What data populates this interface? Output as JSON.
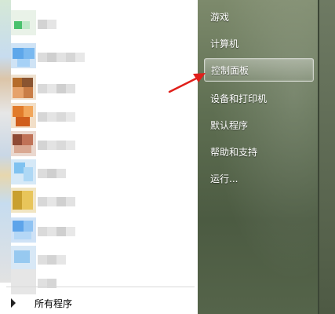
{
  "start_menu": {
    "right_items": [
      {
        "label": "游戏"
      },
      {
        "label": "计算机"
      },
      {
        "label": "控制面板",
        "highlighted": true
      },
      {
        "label": "设备和打印机"
      },
      {
        "label": "默认程序"
      },
      {
        "label": "帮助和支持"
      },
      {
        "label": "运行..."
      }
    ],
    "all_programs_label": "所有程序",
    "annotation_arrow_color": "#e0201b",
    "accent_colors": {
      "right_pane_top": "#7d8a6c",
      "right_pane_bottom": "#4c5b42"
    }
  }
}
